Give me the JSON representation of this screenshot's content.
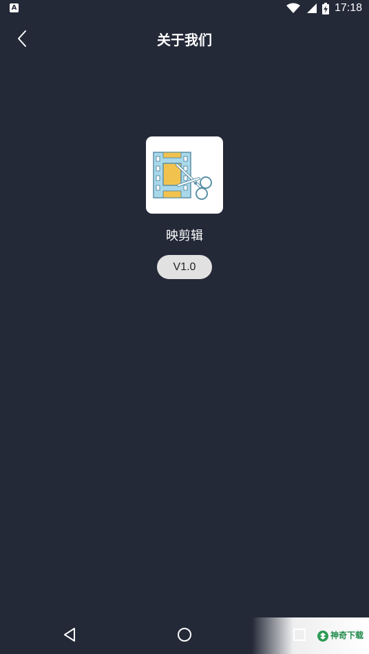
{
  "status_bar": {
    "time": "17:18",
    "left_icon": "A",
    "icons": [
      "wifi-icon",
      "signal-icon",
      "battery-charging-icon"
    ]
  },
  "header": {
    "title": "关于我们",
    "back_icon": "chevron-left-icon"
  },
  "app": {
    "name": "映剪辑",
    "version": "V1.0",
    "logo_icon": "film-scissors-icon"
  },
  "nav_bar": {
    "icons": [
      "nav-back-icon",
      "nav-home-icon",
      "nav-recent-icon"
    ]
  },
  "watermark": {
    "text": "神奇下载"
  },
  "colors": {
    "background": "#242938",
    "version_pill": "#e1e1e1",
    "film_blue": "#a8d8ea",
    "film_yellow": "#f2c24f"
  }
}
